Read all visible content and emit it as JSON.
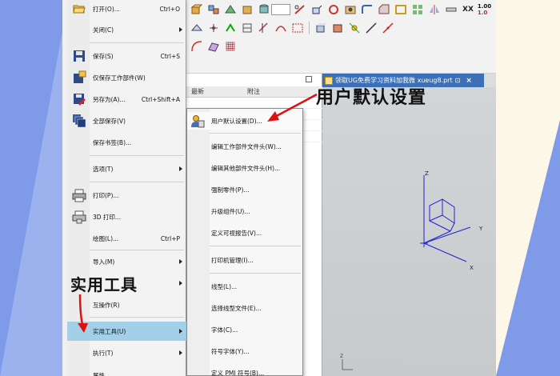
{
  "viewport_tab": {
    "title": "领取UG免费学习资料加我微 xueug8.prt"
  },
  "toolbar": {
    "xx_label": "XX",
    "num_top": "1.00",
    "num_bottom": "1.0"
  },
  "navigator": {
    "columns": [
      "最新",
      "附注"
    ]
  },
  "file_menu": {
    "items": [
      {
        "id": "open",
        "label": "打开(O)...",
        "shortcut": "Ctrl+O",
        "icon": "folder-open-icon"
      },
      {
        "id": "close",
        "label": "关闭(C)",
        "shortcut": "",
        "icon": "",
        "arrow": true
      },
      {
        "id": "save",
        "label": "保存(S)",
        "shortcut": "Ctrl+S",
        "icon": "save-icon"
      },
      {
        "id": "save-work-part",
        "label": "仅保存工作部件(W)",
        "shortcut": "",
        "icon": "save-work-part-icon"
      },
      {
        "id": "save-as",
        "label": "另存为(A)...",
        "shortcut": "Ctrl+Shift+A",
        "icon": "save-as-icon"
      },
      {
        "id": "save-all",
        "label": "全部保存(V)",
        "shortcut": "",
        "icon": "save-all-icon"
      },
      {
        "id": "save-bookmark",
        "label": "保存书签(B)...",
        "shortcut": "",
        "icon": ""
      },
      {
        "id": "options",
        "label": "选项(T)",
        "shortcut": "",
        "icon": "",
        "arrow": true
      },
      {
        "id": "print",
        "label": "打印(P)...",
        "shortcut": "",
        "icon": "printer-icon"
      },
      {
        "id": "print-3d",
        "label": "3D 打印...",
        "shortcut": "",
        "icon": "printer-3d-icon"
      },
      {
        "id": "plot",
        "label": "绘图(L)...",
        "shortcut": "Ctrl+P",
        "icon": ""
      },
      {
        "id": "import",
        "label": "导入(M)",
        "shortcut": "",
        "icon": "",
        "arrow": true
      },
      {
        "id": "export",
        "label": "",
        "shortcut": "",
        "icon": "",
        "arrow": true
      },
      {
        "id": "interop",
        "label": "互操作(R)",
        "shortcut": "",
        "icon": ""
      },
      {
        "id": "utilities",
        "label": "实用工具(U)",
        "shortcut": "",
        "icon": "",
        "arrow": true,
        "active": true
      },
      {
        "id": "execute",
        "label": "执行(T)",
        "shortcut": "",
        "icon": "",
        "arrow": true
      },
      {
        "id": "properties",
        "label": "属性",
        "shortcut": "",
        "icon": ""
      }
    ]
  },
  "utilities_submenu": {
    "items": [
      {
        "id": "user-defaults",
        "label": "用户默认设置(D)...",
        "icon": "user-defaults-icon"
      },
      {
        "id": "edit-part-header",
        "label": "编辑工作部件文件头(W)..."
      },
      {
        "id": "edit-other-header",
        "label": "编辑其他部件文件头(H)..."
      },
      {
        "id": "force-part",
        "label": "强制零件(P)..."
      },
      {
        "id": "upgrade",
        "label": "升级组件(U)..."
      },
      {
        "id": "visual-report",
        "label": "定义可视报告(V)..."
      },
      {
        "id": "printer-mgmt",
        "label": "打印机管理(I)..."
      },
      {
        "id": "linetype",
        "label": "线型(L)..."
      },
      {
        "id": "linetype-file",
        "label": "选择线型文件(E)..."
      },
      {
        "id": "font",
        "label": "字体(C)..."
      },
      {
        "id": "symbol-font",
        "label": "符号字体(Y)..."
      },
      {
        "id": "pmi-symbol",
        "label": "定义 PMI 符号(B)..."
      }
    ]
  },
  "annotations": {
    "user_defaults": "用户默认设置",
    "utilities": "实用工具"
  },
  "colors": {
    "accent_blue": "#3b6fb6",
    "highlight": "#a3d0e8",
    "arrow_red": "#e01010",
    "bg_blue": "#7e9ae8"
  }
}
